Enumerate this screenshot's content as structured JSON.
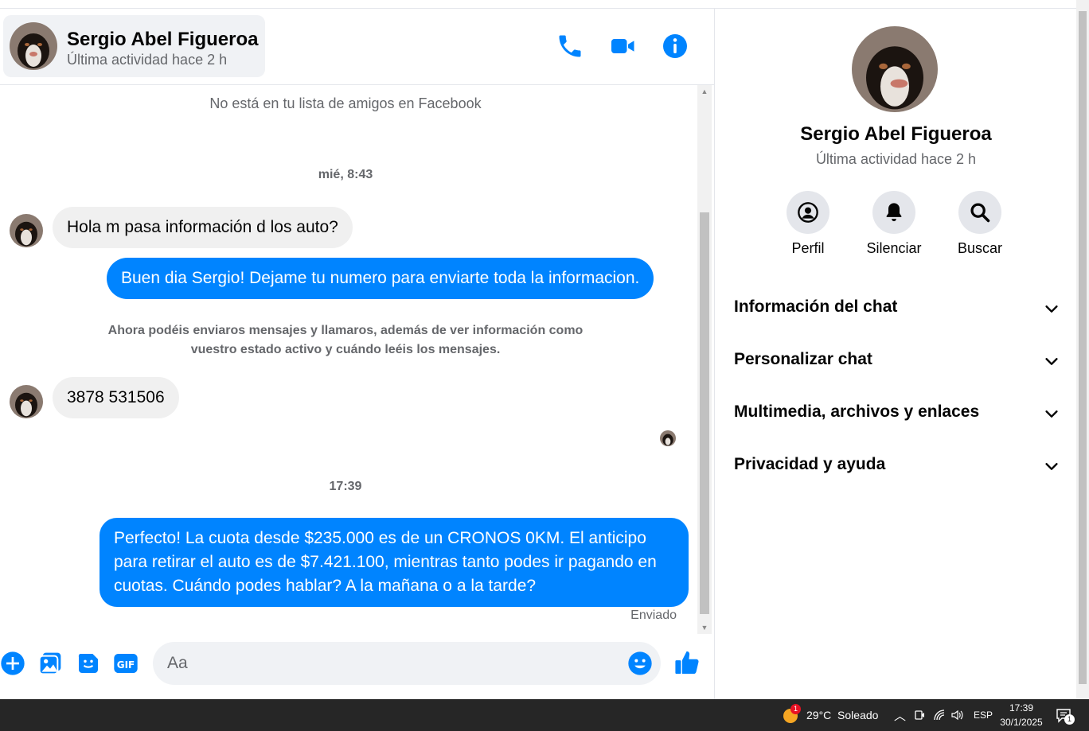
{
  "colors": {
    "accent": "#0084ff",
    "incoming_bubble": "#f0f0f0",
    "muted_text": "#65676b"
  },
  "header": {
    "contact_name": "Sergio Abel Figueroa",
    "contact_status": "Última actividad hace 2 h",
    "icons": [
      "phone-icon",
      "video-camera-icon",
      "info-icon"
    ]
  },
  "messages": {
    "not_friends_notice": "No está en tu lista de amigos en Facebook",
    "timestamp_1": "mié, 8:43",
    "msg_1": "Hola m pasa información d los auto?",
    "msg_2": "Buen dia Sergio! Dejame tu numero para enviarte toda la informacion.",
    "connected_notice": "Ahora podéis enviaros mensajes y llamaros, además de ver información como vuestro estado activo y cuándo leéis los mensajes.",
    "msg_3": "3878 531506",
    "timestamp_2": "17:39",
    "msg_4": "Perfecto! La cuota desde $235.000 es de un CRONOS 0KM. El anticipo para retirar el auto es de $7.421.100, mientras tanto podes ir pagando en cuotas. Cuándo podes hablar? A la mañana o a la tarde?",
    "delivery_status": "Enviado"
  },
  "composer": {
    "placeholder": "Aa",
    "icons": [
      "plus-icon",
      "image-icon",
      "sticker-icon",
      "gif-icon",
      "emoji-icon",
      "thumbs-up-icon"
    ],
    "gif_label": "GIF"
  },
  "panel": {
    "name": "Sergio Abel Figueroa",
    "status": "Última actividad hace 2 h",
    "actions": [
      {
        "label": "Perfil",
        "icon": "profile-icon"
      },
      {
        "label": "Silenciar",
        "icon": "bell-icon"
      },
      {
        "label": "Buscar",
        "icon": "search-icon"
      }
    ],
    "sections": [
      {
        "label": "Información del chat"
      },
      {
        "label": "Personalizar chat"
      },
      {
        "label": "Multimedia, archivos y enlaces"
      },
      {
        "label": "Privacidad y ayuda"
      }
    ]
  },
  "taskbar": {
    "weather_badge": "1",
    "weather": "29°C  Soleado",
    "language": "ESP",
    "time": "17:39",
    "date": "30/1/2025",
    "notification_count": "1"
  }
}
